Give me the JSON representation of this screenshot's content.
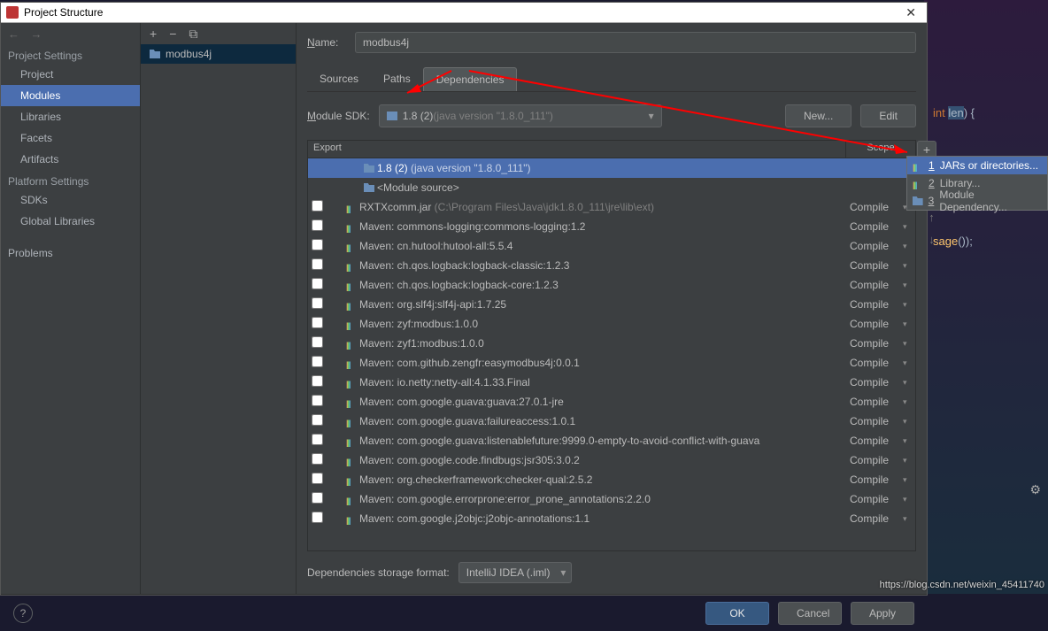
{
  "window": {
    "title": "Project Structure"
  },
  "nav": {
    "sections": {
      "project_settings": "Project Settings",
      "platform_settings": "Platform Settings"
    },
    "items": {
      "project": "Project",
      "modules": "Modules",
      "libraries": "Libraries",
      "facets": "Facets",
      "artifacts": "Artifacts",
      "sdks": "SDKs",
      "global_libraries": "Global Libraries",
      "problems": "Problems"
    }
  },
  "module_list": {
    "module0": "modbus4j"
  },
  "name_field": {
    "label": "Name:",
    "value": "modbus4j"
  },
  "tabs": {
    "sources": "Sources",
    "paths": "Paths",
    "dependencies": "Dependencies"
  },
  "sdk": {
    "label_pre": "M",
    "label_mid": "odule SDK:",
    "value": "1.8 (2)",
    "value_muted": " (java version \"1.8.0_111\")",
    "new_btn": "New...",
    "edit_btn": "Edit"
  },
  "table": {
    "head_export": "Export",
    "head_scope": "Scope",
    "rows": [
      {
        "indent": true,
        "icon": "folder",
        "text": "1.8 (2)",
        "muted": " (java version \"1.8.0_111\")",
        "selected": true,
        "scope": ""
      },
      {
        "indent": true,
        "icon": "folder",
        "text": "<Module source>",
        "scope": ""
      },
      {
        "cb": true,
        "icon": "lib",
        "text": "RXTXcomm.jar",
        "muted": " (C:\\Program Files\\Java\\jdk1.8.0_111\\jre\\lib\\ext)",
        "scope": "Compile"
      },
      {
        "cb": true,
        "icon": "lib",
        "text": "Maven: commons-logging:commons-logging:1.2",
        "scope": "Compile"
      },
      {
        "cb": true,
        "icon": "lib",
        "text": "Maven: cn.hutool:hutool-all:5.5.4",
        "scope": "Compile"
      },
      {
        "cb": true,
        "icon": "lib",
        "text": "Maven: ch.qos.logback:logback-classic:1.2.3",
        "scope": "Compile"
      },
      {
        "cb": true,
        "icon": "lib",
        "text": "Maven: ch.qos.logback:logback-core:1.2.3",
        "scope": "Compile"
      },
      {
        "cb": true,
        "icon": "lib",
        "text": "Maven: org.slf4j:slf4j-api:1.7.25",
        "scope": "Compile"
      },
      {
        "cb": true,
        "icon": "lib",
        "text": "Maven: zyf:modbus:1.0.0",
        "scope": "Compile"
      },
      {
        "cb": true,
        "icon": "lib",
        "text": "Maven: zyf1:modbus:1.0.0",
        "scope": "Compile"
      },
      {
        "cb": true,
        "icon": "lib",
        "text": "Maven: com.github.zengfr:easymodbus4j:0.0.1",
        "scope": "Compile"
      },
      {
        "cb": true,
        "icon": "lib",
        "text": "Maven: io.netty:netty-all:4.1.33.Final",
        "scope": "Compile"
      },
      {
        "cb": true,
        "icon": "lib",
        "text": "Maven: com.google.guava:guava:27.0.1-jre",
        "scope": "Compile"
      },
      {
        "cb": true,
        "icon": "lib",
        "text": "Maven: com.google.guava:failureaccess:1.0.1",
        "scope": "Compile"
      },
      {
        "cb": true,
        "icon": "lib",
        "text": "Maven: com.google.guava:listenablefuture:9999.0-empty-to-avoid-conflict-with-guava",
        "scope": "Compile"
      },
      {
        "cb": true,
        "icon": "lib",
        "text": "Maven: com.google.code.findbugs:jsr305:3.0.2",
        "scope": "Compile"
      },
      {
        "cb": true,
        "icon": "lib",
        "text": "Maven: org.checkerframework:checker-qual:2.5.2",
        "scope": "Compile"
      },
      {
        "cb": true,
        "icon": "lib",
        "text": "Maven: com.google.errorprone:error_prone_annotations:2.2.0",
        "scope": "Compile"
      },
      {
        "cb": true,
        "icon": "lib",
        "text": "Maven: com.google.j2objc:j2objc-annotations:1.1",
        "scope": "Compile"
      }
    ]
  },
  "storage": {
    "label": "Dependencies storage format:",
    "value": "IntelliJ IDEA (.iml)"
  },
  "buttons": {
    "ok": "OK",
    "cancel": "Cancel",
    "apply": "Apply"
  },
  "popup": {
    "items": [
      {
        "num": "1",
        "label": " JARs or directories..."
      },
      {
        "num": "2",
        "label": " Library..."
      },
      {
        "num": "3",
        "label": " Module Dependency..."
      }
    ]
  },
  "code_bg": {
    "kw": "int ",
    "var": "len",
    "tail": ")  {",
    "call": "sage",
    "call_tail": "());"
  },
  "watermark": "https://blog.csdn.net/weixin_45411740"
}
